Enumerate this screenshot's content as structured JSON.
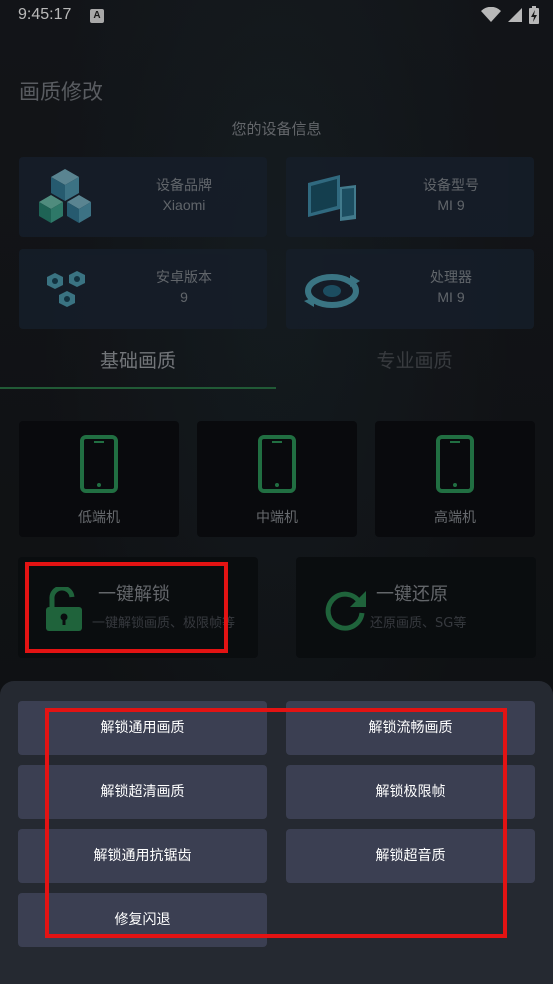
{
  "status_bar": {
    "time": "9:45:17",
    "notification_glyph": "A"
  },
  "header": {
    "title": "画质修改",
    "device_info_title": "您的设备信息"
  },
  "device_info": [
    {
      "label": "设备品牌",
      "value": "Xiaomi",
      "icon": "cubes-icon"
    },
    {
      "label": "设备型号",
      "value": "MI 9",
      "icon": "devices-icon"
    },
    {
      "label": "安卓版本",
      "value": "9",
      "icon": "nuts-icon"
    },
    {
      "label": "处理器",
      "value": "MI 9",
      "icon": "processor-sync-icon"
    }
  ],
  "tabs": [
    {
      "label": "基础画质",
      "selected": true
    },
    {
      "label": "专业画质",
      "selected": false
    }
  ],
  "tiers": [
    {
      "label": "低端机"
    },
    {
      "label": "中端机"
    },
    {
      "label": "高端机"
    }
  ],
  "actions": {
    "unlock": {
      "title": "一键解锁",
      "subtitle": "一键解锁画质、极限帧等"
    },
    "restore": {
      "title": "一键还原",
      "subtitle": "还原画质、SG等"
    }
  },
  "sheet": {
    "buttons": [
      "解锁通用画质",
      "解锁流畅画质",
      "解锁超清画质",
      "解锁极限帧",
      "解锁通用抗锯齿",
      "解锁超音质",
      "修复闪退"
    ]
  },
  "colors": {
    "accent": "#2f7d4b",
    "highlight": "#e31313",
    "sheet_bg": "#252931",
    "button_bg": "#3b3f52"
  }
}
